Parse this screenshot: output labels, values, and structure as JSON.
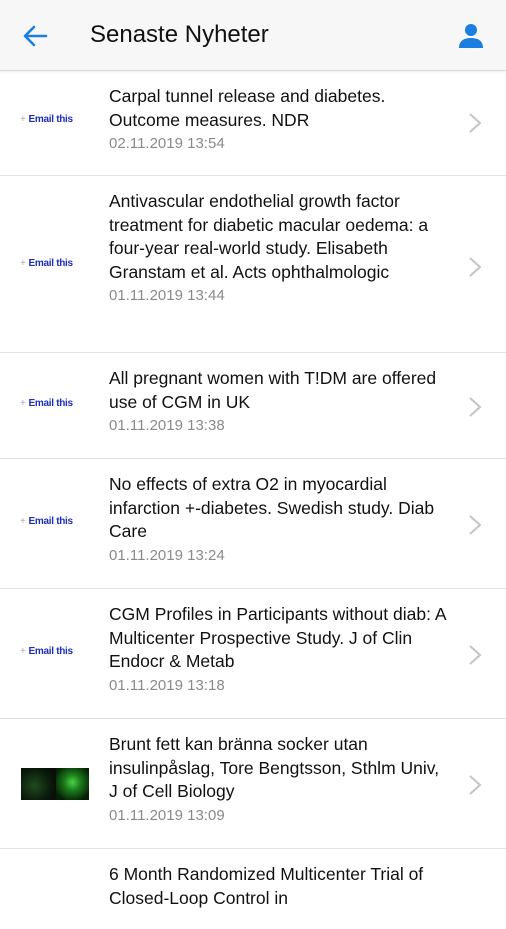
{
  "header": {
    "title": "Senaste Nyheter",
    "back_icon": "arrow-left-icon",
    "profile_icon": "person-icon",
    "accent_color": "#1a7fe0"
  },
  "email_label": "Email this",
  "news": [
    {
      "title": "Carpal tunnel release and diabetes. Outcome measures. NDR",
      "date": "02.11.2019 13:54"
    },
    {
      "title": "Antivascular endothelial growth factor treatment for diabetic macular oedema: a four-year real-world study. Elisabeth Granstam et al. Acts ophthalmologic",
      "date": "01.11.2019 13:44"
    },
    {
      "title": "All pregnant women with T!DM are offered use of CGM in UK",
      "date": "01.11.2019 13:38"
    },
    {
      "title": "No effects of extra O2 in myocardial infarction +-diabetes. Swedish study. Diab Care",
      "date": "01.11.2019 13:24"
    },
    {
      "title": "CGM Profiles in Participants without diab: A Multicenter Prospective Study. J of Clin Endocr & Metab",
      "date": "01.11.2019 13:18"
    },
    {
      "title": "Brunt fett kan bränna socker utan insulinpåslag, Tore Bengtsson, Sthlm Univ, J of Cell Biology",
      "date": "01.11.2019 13:09"
    },
    {
      "title": "6 Month Randomized Multicenter Trial of Closed-Loop Control in",
      "date": ""
    }
  ]
}
